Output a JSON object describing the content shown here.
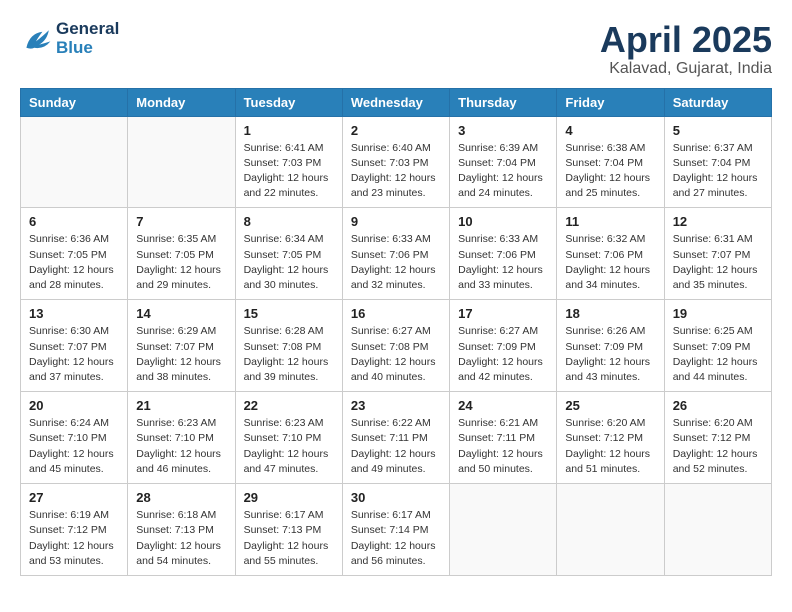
{
  "header": {
    "logo_general": "General",
    "logo_blue": "Blue",
    "title": "April 2025",
    "location": "Kalavad, Gujarat, India"
  },
  "weekdays": [
    "Sunday",
    "Monday",
    "Tuesday",
    "Wednesday",
    "Thursday",
    "Friday",
    "Saturday"
  ],
  "weeks": [
    [
      {
        "day": "",
        "info": ""
      },
      {
        "day": "",
        "info": ""
      },
      {
        "day": "1",
        "info": "Sunrise: 6:41 AM\nSunset: 7:03 PM\nDaylight: 12 hours\nand 22 minutes."
      },
      {
        "day": "2",
        "info": "Sunrise: 6:40 AM\nSunset: 7:03 PM\nDaylight: 12 hours\nand 23 minutes."
      },
      {
        "day": "3",
        "info": "Sunrise: 6:39 AM\nSunset: 7:04 PM\nDaylight: 12 hours\nand 24 minutes."
      },
      {
        "day": "4",
        "info": "Sunrise: 6:38 AM\nSunset: 7:04 PM\nDaylight: 12 hours\nand 25 minutes."
      },
      {
        "day": "5",
        "info": "Sunrise: 6:37 AM\nSunset: 7:04 PM\nDaylight: 12 hours\nand 27 minutes."
      }
    ],
    [
      {
        "day": "6",
        "info": "Sunrise: 6:36 AM\nSunset: 7:05 PM\nDaylight: 12 hours\nand 28 minutes."
      },
      {
        "day": "7",
        "info": "Sunrise: 6:35 AM\nSunset: 7:05 PM\nDaylight: 12 hours\nand 29 minutes."
      },
      {
        "day": "8",
        "info": "Sunrise: 6:34 AM\nSunset: 7:05 PM\nDaylight: 12 hours\nand 30 minutes."
      },
      {
        "day": "9",
        "info": "Sunrise: 6:33 AM\nSunset: 7:06 PM\nDaylight: 12 hours\nand 32 minutes."
      },
      {
        "day": "10",
        "info": "Sunrise: 6:33 AM\nSunset: 7:06 PM\nDaylight: 12 hours\nand 33 minutes."
      },
      {
        "day": "11",
        "info": "Sunrise: 6:32 AM\nSunset: 7:06 PM\nDaylight: 12 hours\nand 34 minutes."
      },
      {
        "day": "12",
        "info": "Sunrise: 6:31 AM\nSunset: 7:07 PM\nDaylight: 12 hours\nand 35 minutes."
      }
    ],
    [
      {
        "day": "13",
        "info": "Sunrise: 6:30 AM\nSunset: 7:07 PM\nDaylight: 12 hours\nand 37 minutes."
      },
      {
        "day": "14",
        "info": "Sunrise: 6:29 AM\nSunset: 7:07 PM\nDaylight: 12 hours\nand 38 minutes."
      },
      {
        "day": "15",
        "info": "Sunrise: 6:28 AM\nSunset: 7:08 PM\nDaylight: 12 hours\nand 39 minutes."
      },
      {
        "day": "16",
        "info": "Sunrise: 6:27 AM\nSunset: 7:08 PM\nDaylight: 12 hours\nand 40 minutes."
      },
      {
        "day": "17",
        "info": "Sunrise: 6:27 AM\nSunset: 7:09 PM\nDaylight: 12 hours\nand 42 minutes."
      },
      {
        "day": "18",
        "info": "Sunrise: 6:26 AM\nSunset: 7:09 PM\nDaylight: 12 hours\nand 43 minutes."
      },
      {
        "day": "19",
        "info": "Sunrise: 6:25 AM\nSunset: 7:09 PM\nDaylight: 12 hours\nand 44 minutes."
      }
    ],
    [
      {
        "day": "20",
        "info": "Sunrise: 6:24 AM\nSunset: 7:10 PM\nDaylight: 12 hours\nand 45 minutes."
      },
      {
        "day": "21",
        "info": "Sunrise: 6:23 AM\nSunset: 7:10 PM\nDaylight: 12 hours\nand 46 minutes."
      },
      {
        "day": "22",
        "info": "Sunrise: 6:23 AM\nSunset: 7:10 PM\nDaylight: 12 hours\nand 47 minutes."
      },
      {
        "day": "23",
        "info": "Sunrise: 6:22 AM\nSunset: 7:11 PM\nDaylight: 12 hours\nand 49 minutes."
      },
      {
        "day": "24",
        "info": "Sunrise: 6:21 AM\nSunset: 7:11 PM\nDaylight: 12 hours\nand 50 minutes."
      },
      {
        "day": "25",
        "info": "Sunrise: 6:20 AM\nSunset: 7:12 PM\nDaylight: 12 hours\nand 51 minutes."
      },
      {
        "day": "26",
        "info": "Sunrise: 6:20 AM\nSunset: 7:12 PM\nDaylight: 12 hours\nand 52 minutes."
      }
    ],
    [
      {
        "day": "27",
        "info": "Sunrise: 6:19 AM\nSunset: 7:12 PM\nDaylight: 12 hours\nand 53 minutes."
      },
      {
        "day": "28",
        "info": "Sunrise: 6:18 AM\nSunset: 7:13 PM\nDaylight: 12 hours\nand 54 minutes."
      },
      {
        "day": "29",
        "info": "Sunrise: 6:17 AM\nSunset: 7:13 PM\nDaylight: 12 hours\nand 55 minutes."
      },
      {
        "day": "30",
        "info": "Sunrise: 6:17 AM\nSunset: 7:14 PM\nDaylight: 12 hours\nand 56 minutes."
      },
      {
        "day": "",
        "info": ""
      },
      {
        "day": "",
        "info": ""
      },
      {
        "day": "",
        "info": ""
      }
    ]
  ]
}
